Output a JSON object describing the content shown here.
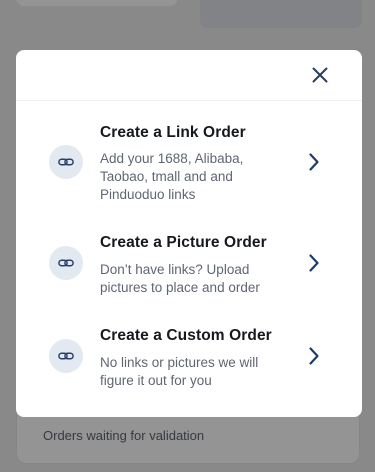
{
  "background": {
    "bottom_card_text": "Orders waiting for validation"
  },
  "modal": {
    "close_icon": "close-icon",
    "options": [
      {
        "title": "Create a Link Order",
        "description": "Add your 1688, Alibaba, Taobao, tmall and and Pinduoduo links",
        "icon": "link-icon",
        "chevron": "chevron-right-icon"
      },
      {
        "title": "Create a Picture Order",
        "description": "Don’t have links? Upload pictures to place and order",
        "icon": "link-icon",
        "chevron": "chevron-right-icon"
      },
      {
        "title": "Create a Custom Order",
        "description": "No links or pictures we will figure it out for you",
        "icon": "link-icon",
        "chevron": "chevron-right-icon"
      }
    ]
  },
  "colors": {
    "icon_circle_bg": "#e3e9f1",
    "icon_stroke": "#2a3f68",
    "chevron": "#1e3a6e",
    "title_text": "#15181d",
    "desc_text": "#5f6672",
    "overlay": "rgba(0,0,0,0.42)"
  }
}
